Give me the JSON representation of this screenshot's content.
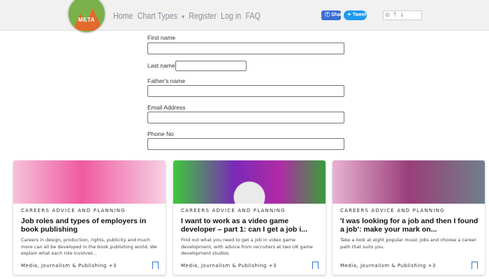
{
  "header": {
    "logo_text": "META",
    "nav": [
      "Home",
      "Chart Types",
      "▾",
      "Register",
      "Log in",
      "FAQ"
    ],
    "share_facebook": "Share",
    "share_twitter": "Tweet",
    "vote_widget": "⊚ ↑ ↓"
  },
  "form": {
    "first_name_label": "First name",
    "last_name_label": "Last name",
    "father_name_label": "Father's name",
    "email_label": "Email Address",
    "phone_label": "Phone No",
    "first_name_value": "",
    "last_name_value": "",
    "father_name_value": "",
    "email_value": "",
    "phone_value": ""
  },
  "cards": [
    {
      "kicker": "CAREERS ADVICE AND PLANNING",
      "title": "Job roles and types of employers in book publishing",
      "desc": "Careers in design, production, rights, publicity and much more can all be developed in the book publishing world. We explain what each role involves...",
      "tags": "Media, Journalism & Publishing +3"
    },
    {
      "kicker": "CAREERS ADVICE AND PLANNING",
      "title": "I want to work as a video game developer – part 1: can I get a job i...",
      "desc": "Find out what you need to get a job in video game development, with advice from recruiters at two UK game development studios.",
      "tags": "Media, Journalism & Publishing +3"
    },
    {
      "kicker": "CAREERS ADVICE AND PLANNING",
      "title": "'I was looking for a job and then I found a job': make your mark on...",
      "desc": "Take a look at eight popular music jobs and choose a career path that suits you.",
      "tags": "Media, Journalism & Publishing +3"
    }
  ]
}
